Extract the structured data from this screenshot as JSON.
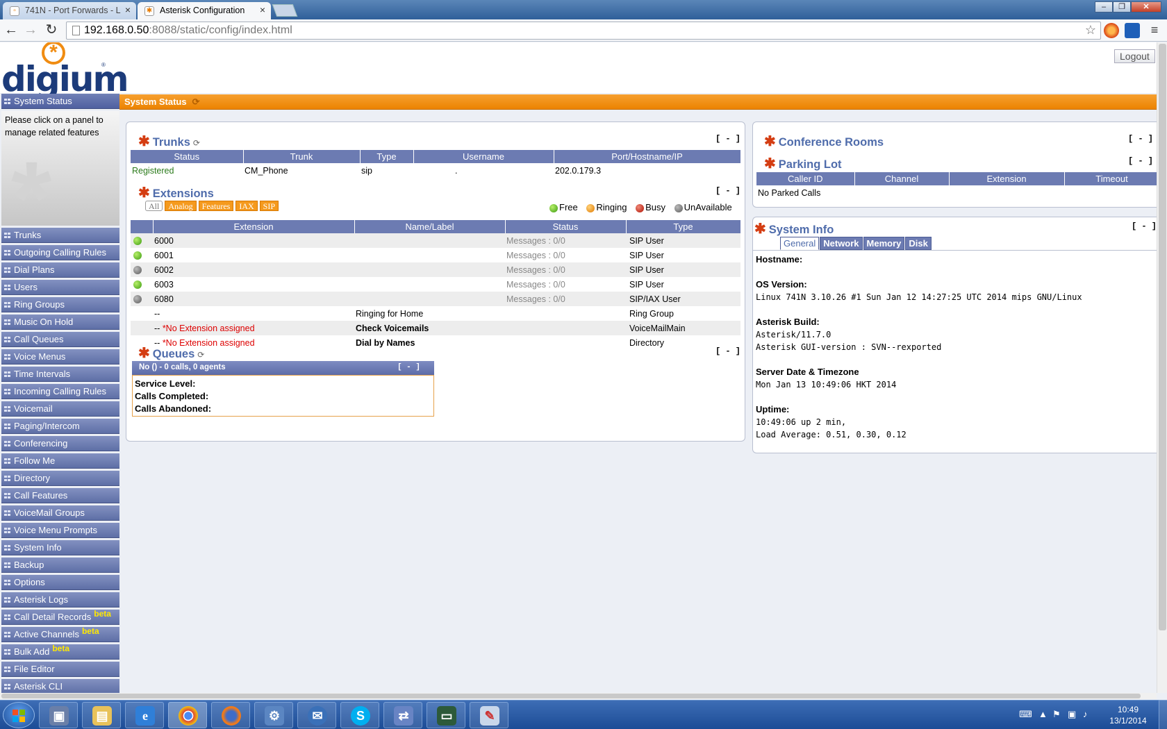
{
  "browser": {
    "tabs": [
      {
        "title": "741N - Port Forwards - L",
        "active": false
      },
      {
        "title": "Asterisk Configuration",
        "active": true
      }
    ],
    "url_host": "192.168.0.50",
    "url_rest": ":8088/static/config/index.html"
  },
  "header": {
    "logo_text": "digium",
    "logout_label": "Logout"
  },
  "sidebar": {
    "active_item": "System Status",
    "help_text": "Please click on a panel to manage related features",
    "items": [
      {
        "label": "Trunks",
        "beta": ""
      },
      {
        "label": "Outgoing Calling Rules",
        "beta": ""
      },
      {
        "label": "Dial Plans",
        "beta": ""
      },
      {
        "label": "Users",
        "beta": ""
      },
      {
        "label": "Ring Groups",
        "beta": ""
      },
      {
        "label": "Music On Hold",
        "beta": ""
      },
      {
        "label": "Call Queues",
        "beta": ""
      },
      {
        "label": "Voice Menus",
        "beta": ""
      },
      {
        "label": "Time Intervals",
        "beta": ""
      },
      {
        "label": "Incoming Calling Rules",
        "beta": ""
      },
      {
        "label": "Voicemail",
        "beta": ""
      },
      {
        "label": "Paging/Intercom",
        "beta": ""
      },
      {
        "label": "Conferencing",
        "beta": ""
      },
      {
        "label": "Follow Me",
        "beta": ""
      },
      {
        "label": "Directory",
        "beta": ""
      },
      {
        "label": "Call Features",
        "beta": ""
      },
      {
        "label": "VoiceMail Groups",
        "beta": ""
      },
      {
        "label": "Voice Menu Prompts",
        "beta": ""
      },
      {
        "label": "System Info",
        "beta": ""
      },
      {
        "label": "Backup",
        "beta": ""
      },
      {
        "label": "Options",
        "beta": ""
      },
      {
        "label": "Asterisk Logs",
        "beta": ""
      },
      {
        "label": "Call Detail Records",
        "beta": "beta"
      },
      {
        "label": "Active Channels",
        "beta": "beta"
      },
      {
        "label": "Bulk Add",
        "beta": "beta"
      },
      {
        "label": "File Editor",
        "beta": ""
      },
      {
        "label": "Asterisk CLI",
        "beta": ""
      }
    ]
  },
  "content": {
    "title": "System Status",
    "collapse_label": "[ - ]",
    "trunks": {
      "title": "Trunks",
      "columns": [
        "Status",
        "Trunk",
        "Type",
        "Username",
        "Port/Hostname/IP"
      ],
      "rows": [
        {
          "status": "Registered",
          "trunk": "CM_Phone",
          "type": "sip",
          "username": ".",
          "host": "202.0.179.3"
        }
      ]
    },
    "extensions": {
      "title": "Extensions",
      "filters": [
        "All",
        "Analog",
        "Features",
        "IAX",
        "SIP"
      ],
      "legend": [
        "Free",
        "Ringing",
        "Busy",
        "UnAvailable"
      ],
      "columns": [
        "Extension",
        "Name/Label",
        "Status",
        "Type"
      ],
      "rows": [
        {
          "state": "free",
          "ext": "6000",
          "name": "",
          "status": "Messages : 0/0",
          "type": "SIP User"
        },
        {
          "state": "free",
          "ext": "6001",
          "name": "",
          "status": "Messages : 0/0",
          "type": "SIP User"
        },
        {
          "state": "unavailable",
          "ext": "6002",
          "name": "",
          "status": "Messages : 0/0",
          "type": "SIP User"
        },
        {
          "state": "free",
          "ext": "6003",
          "name": "",
          "status": "Messages : 0/0",
          "type": "SIP User"
        },
        {
          "state": "unavailable",
          "ext": "6080",
          "name": "",
          "status": "Messages : 0/0",
          "type": "SIP/IAX User"
        },
        {
          "state": "",
          "ext": "--",
          "ext_note": "",
          "name": "Ringing for Home",
          "status": "",
          "type": "Ring Group"
        },
        {
          "state": "",
          "ext": "-- ",
          "ext_note": "*No Extension assigned",
          "name": "Check Voicemails",
          "status": "",
          "type": "VoiceMailMain"
        },
        {
          "state": "",
          "ext": "-- ",
          "ext_note": "*No Extension assigned",
          "name": "Dial by Names",
          "status": "",
          "type": "Directory"
        }
      ]
    },
    "queues": {
      "title": "Queues",
      "header": "No () - 0 calls, 0 agents",
      "lines": [
        "Service Level:",
        "Calls Completed:",
        "Calls Abandoned:"
      ]
    },
    "conference": {
      "title": "Conference Rooms"
    },
    "parking": {
      "title": "Parking Lot",
      "columns": [
        "Caller ID",
        "Channel",
        "Extension",
        "Timeout"
      ],
      "empty": "No Parked Calls"
    },
    "system_info": {
      "title": "System Info",
      "tabs": [
        "General",
        "Network",
        "Memory",
        "Disk"
      ],
      "hostname_label": "Hostname:",
      "os_label": "OS Version:",
      "os_value": "Linux 741N 3.10.26 #1 Sun Jan 12 14:27:25 UTC 2014 mips GNU/Linux",
      "build_label": "Asterisk Build:",
      "build_value": "Asterisk/11.7.0",
      "gui_value": "Asterisk GUI-version : SVN--rexported",
      "date_label": "Server Date & Timezone",
      "date_value": "Mon Jan 13 10:49:06 HKT 2014",
      "uptime_label": "Uptime:",
      "uptime_value": "10:49:06 up 2 min,",
      "load_value": "Load Average: 0.51, 0.30, 0.12"
    }
  },
  "taskbar": {
    "time": "10:49",
    "date": "13/1/2014"
  }
}
